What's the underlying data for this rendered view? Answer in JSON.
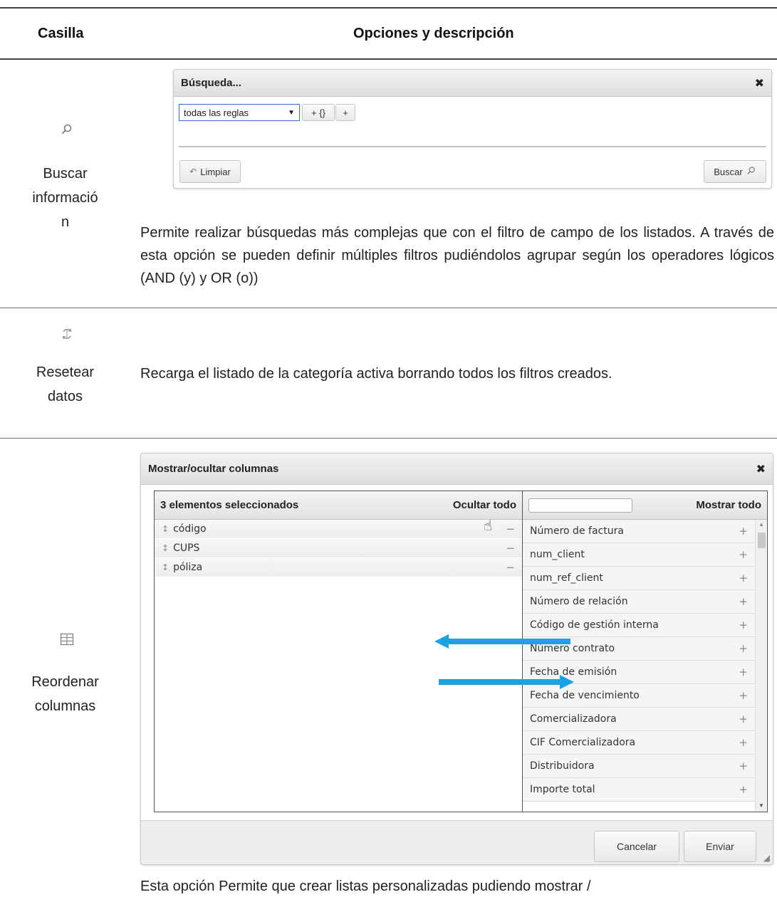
{
  "table": {
    "header_col1": "Casilla",
    "header_col2": "Opciones y descripción"
  },
  "rows": [
    {
      "label_lines": [
        "Buscar",
        "informació",
        "n"
      ],
      "icon": "search-icon",
      "description": "Permite realizar búsquedas más complejas que con el filtro de campo de los listados. A través de esta opción se pueden definir múltiples filtros pudiéndolos agrupar según los operadores lógicos (AND (y) y OR (o))"
    },
    {
      "label_lines": [
        "Resetear",
        "datos"
      ],
      "icon": "refresh-icon",
      "description": "Recarga el listado de la categoría activa borrando todos los filtros creados."
    },
    {
      "label_lines": [
        "Reordenar",
        "columnas"
      ],
      "icon": "table-grid-icon",
      "description": "Esta opción Permite que crear listas personalizadas pudiendo mostrar /"
    }
  ],
  "search_dialog": {
    "title": "Búsqueda...",
    "close": "✖",
    "select_value": "todas las reglas",
    "group_button": "+ {}",
    "add_button": "+",
    "clear_button": "Limpiar",
    "search_button": "Buscar"
  },
  "columns_dialog": {
    "title": "Mostrar/ocultar columnas",
    "close": "✖",
    "selected_header": "3 elementos seleccionados",
    "hide_all": "Ocultar todo",
    "show_all": "Mostrar todo",
    "selected_items": [
      "código",
      "CUPS",
      "póliza"
    ],
    "available_items": [
      "Número de factura",
      "num_client",
      "num_ref_client",
      "Número de relación",
      "Código de gestión interna",
      "Número contrato",
      "Fecha de emisión",
      "Fecha de vencimiento",
      "Comercializadora",
      "CIF Comercializadora",
      "Distribuidora",
      "Importe total"
    ],
    "cancel_button": "Cancelar",
    "submit_button": "Enviar",
    "arrow_color": "#1aa3e0"
  }
}
